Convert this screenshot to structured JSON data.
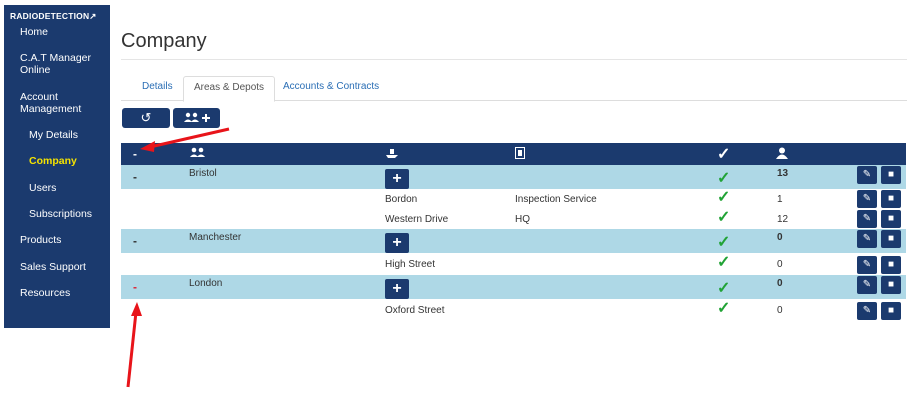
{
  "brand": "RADIODETECTION↗",
  "sidebar": {
    "items": [
      {
        "label": "Home"
      },
      {
        "label": "C.A.T Manager"
      },
      {
        "label": "Online"
      },
      {
        "label": "Account"
      },
      {
        "label": "Management"
      },
      {
        "label": "My Details"
      },
      {
        "label": "Company"
      },
      {
        "label": "Users"
      },
      {
        "label": "Subscriptions"
      },
      {
        "label": "Products"
      },
      {
        "label": "Sales Support"
      },
      {
        "label": "Resources"
      }
    ]
  },
  "page": {
    "title": "Company"
  },
  "tabs": [
    {
      "label": "Details"
    },
    {
      "label": "Areas & Depots"
    },
    {
      "label": "Accounts & Contracts"
    }
  ],
  "toolbar": {
    "refresh_icon": "↺",
    "add_group_icon": "+"
  },
  "table": {
    "header_collapse": "-",
    "rows": [
      {
        "type": "area",
        "toggle": "-",
        "name": "Bristol",
        "count": "13"
      },
      {
        "type": "depot",
        "name": "Bordon",
        "detail": "Inspection Service",
        "count": "1"
      },
      {
        "type": "depot",
        "name": "Western Drive",
        "detail": "HQ",
        "count": "12"
      },
      {
        "type": "area",
        "toggle": "-",
        "name": "Manchester",
        "count": "0"
      },
      {
        "type": "depot",
        "name": "High Street",
        "detail": "",
        "count": "0"
      },
      {
        "type": "area",
        "toggle": "-",
        "name": "London",
        "count": "0"
      },
      {
        "type": "depot",
        "name": "Oxford Street",
        "detail": "",
        "count": "0"
      }
    ],
    "check_glyph": "✓",
    "add_glyph": "+",
    "edit_glyph": "✎",
    "delete_glyph": "■"
  },
  "colors": {
    "sidebar_bg": "#1b3a6e",
    "active_nav": "#f5e300",
    "area_row_bg": "#aed8e6",
    "check_green": "#21a336",
    "annotation_arrow": "#e8141a"
  }
}
